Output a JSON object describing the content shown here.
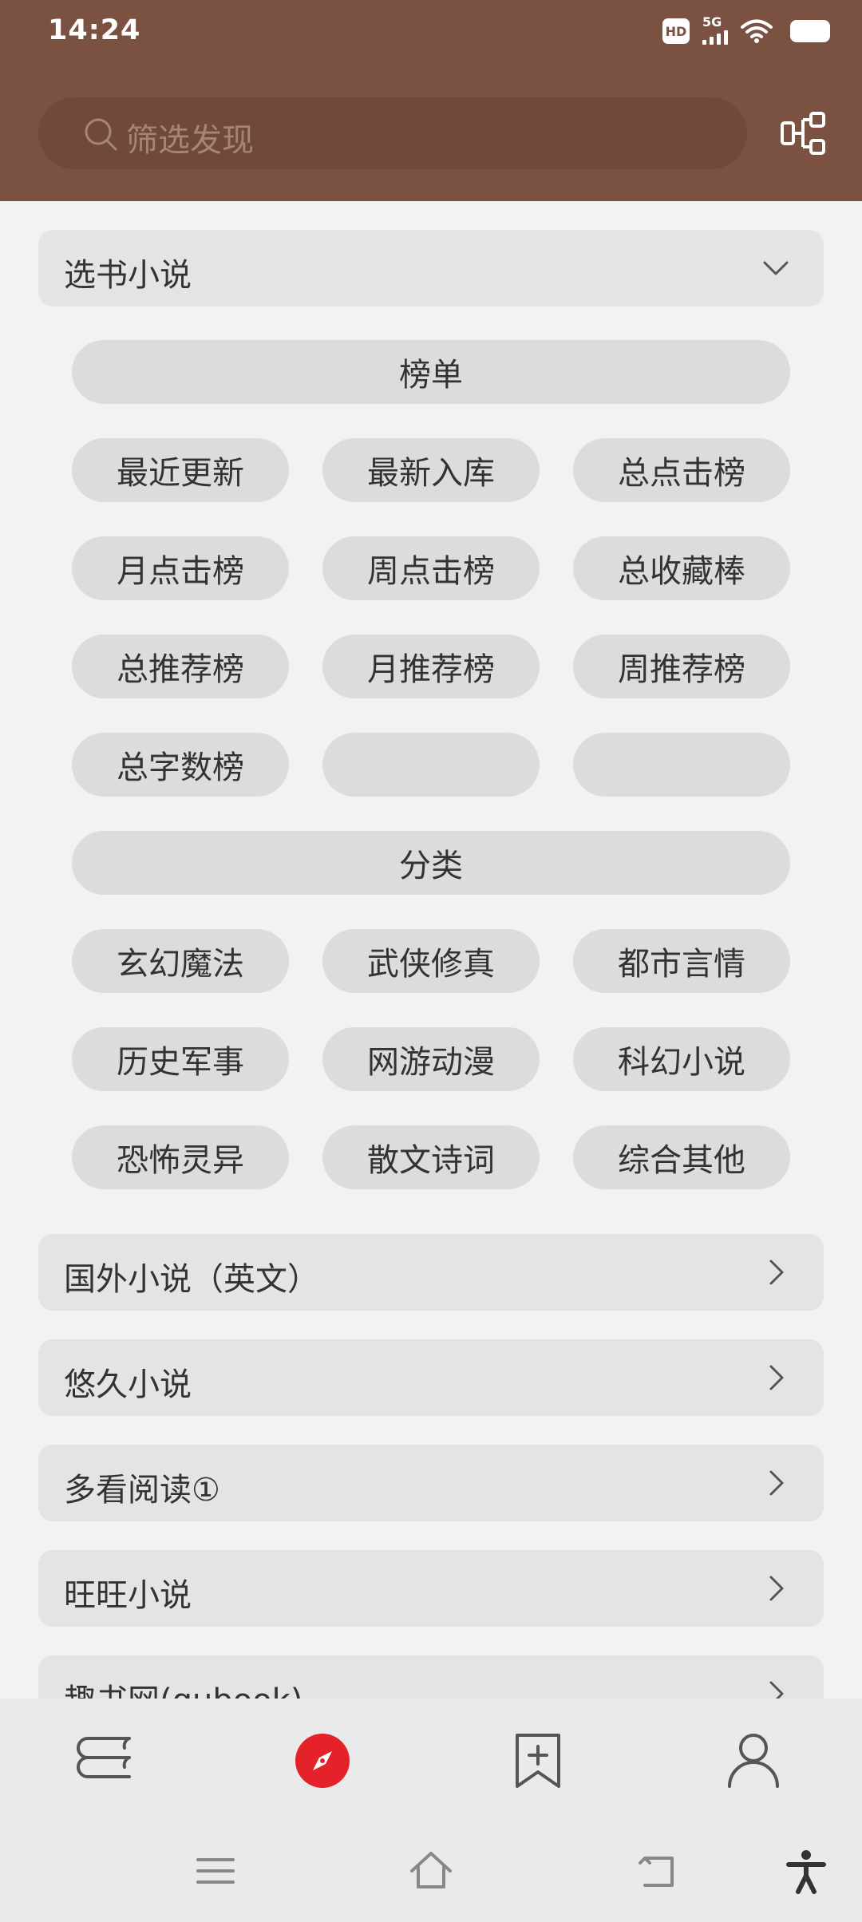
{
  "status": {
    "time": "14:24",
    "hd": "HD",
    "network": "5G"
  },
  "search": {
    "placeholder": "筛选发现"
  },
  "groups": {
    "expanded": {
      "title": "选书小说",
      "sections": [
        {
          "header": "榜单",
          "items": [
            "最近更新",
            "最新入库",
            "总点击榜",
            "月点击榜",
            "周点击榜",
            "总收藏棒",
            "总推荐榜",
            "月推荐榜",
            "周推荐榜",
            "总字数榜",
            "",
            ""
          ]
        },
        {
          "header": "分类",
          "items": [
            "玄幻魔法",
            "武侠修真",
            "都市言情",
            "历史军事",
            "网游动漫",
            "科幻小说",
            "恐怖灵异",
            "散文诗词",
            "综合其他"
          ]
        }
      ]
    },
    "collapsed": [
      "国外小说（英文）",
      "悠久小说",
      "多看阅读①",
      "旺旺小说",
      "趣书网(qubook)"
    ]
  },
  "bottom_nav": {
    "items": [
      "bookshelf-icon",
      "explore-icon",
      "bookmark-add-icon",
      "profile-icon"
    ],
    "active": "explore-icon",
    "accent": "#e5222a"
  },
  "colors": {
    "header": "#7b5142",
    "search_bg": "#714939",
    "chip_bg": "#dcdcdc",
    "group_bg": "#e4e4e4"
  }
}
